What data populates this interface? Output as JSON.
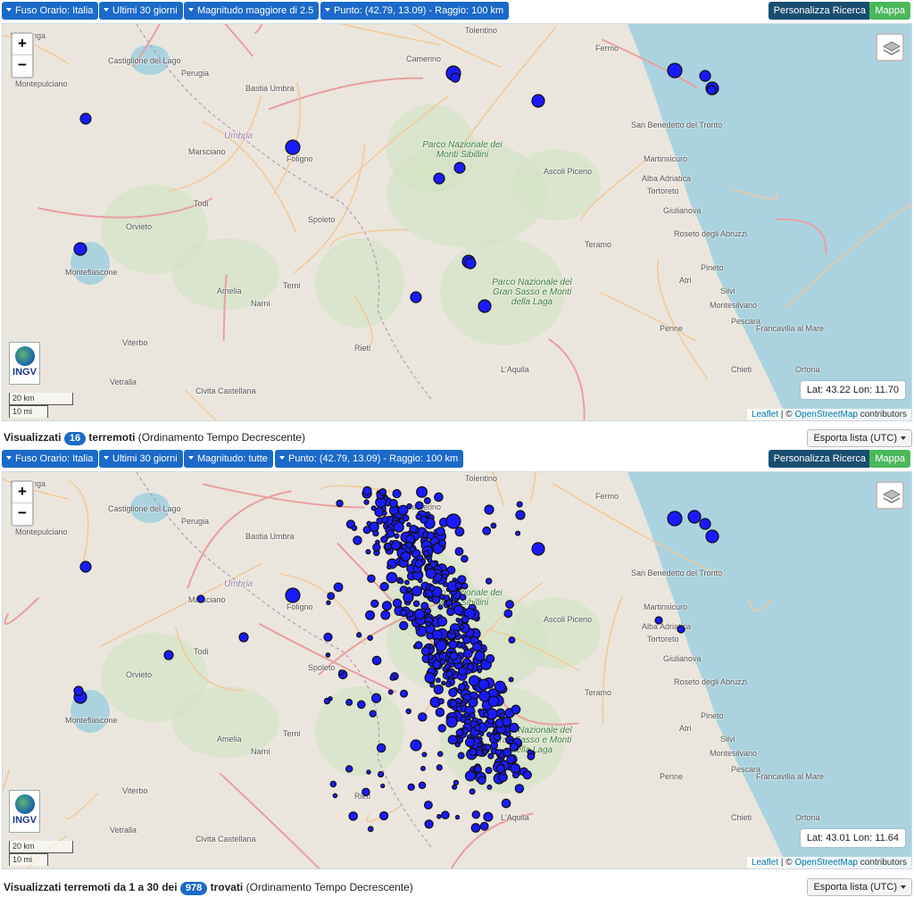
{
  "panels": [
    {
      "filters": {
        "timezone": "Fuso Orario: Italia",
        "period": "Ultimi 30 giorni",
        "magnitude": "Magnitudo maggiore di 2.5",
        "point": "Punto: (42.79, 13.09) - Raggio: 100 km"
      },
      "personalize_label": "Personalizza Ricerca",
      "map_label": "Mappa",
      "coords": "Lat: 43.22 Lon: 11.70",
      "summary": {
        "prefix": "Visualizzati",
        "count": "16",
        "noun": "terremoti",
        "sort": "(Ordinamento Tempo Decrescente)"
      },
      "export_label": "Esporta lista (UTC)",
      "quake_count_shown": 16
    },
    {
      "filters": {
        "timezone": "Fuso Orario: Italia",
        "period": "Ultimi 30 giorni",
        "magnitude": "Magnitudo: tutte",
        "point": "Punto: (42.79, 13.09) - Raggio: 100 km"
      },
      "personalize_label": "Personalizza Ricerca",
      "map_label": "Mappa",
      "coords": "Lat: 43.01 Lon: 11.64",
      "summary": {
        "prefix": "Visualizzati terremoti da 1 a 30 dei",
        "count": "978",
        "noun": "trovati",
        "sort": "(Ordinamento Tempo Decrescente)"
      },
      "export_label": "Esporta lista (UTC)",
      "quake_count_shown": 978
    }
  ],
  "map": {
    "zoom_in": "+",
    "zoom_out": "−",
    "logo_text": "INGV",
    "scale_km": "20 km",
    "scale_mi": "10 mi",
    "attribution_leaflet": "Leaflet",
    "attribution_sep": " | © ",
    "attribution_osm": "OpenStreetMap",
    "attribution_suffix": " contributors",
    "places": [
      "Sinalunga",
      "Castiglione del Lago",
      "Montepulciano",
      "Perugia",
      "Bastia Umbra",
      "Marsciano",
      "Umbria",
      "Foligno",
      "Todi",
      "Orvieto",
      "Spoleto",
      "Montefiascone",
      "Amelia",
      "Terni",
      "Narni",
      "Viterbo",
      "Vetralla",
      "Civita Castellana",
      "Rieti",
      "L'Aquila",
      "Camerino",
      "Tolentino",
      "Fermo",
      "San Benedetto del Tronto",
      "Ascoli Piceno",
      "Martinsicuro",
      "Alba Adriatica",
      "Tortoreto",
      "Giulianova",
      "Roseto degli Abruzzi",
      "Teramo",
      "Pineto",
      "Atri",
      "Silvi",
      "Montesilvano",
      "Pescara",
      "Francavilla al Mare",
      "Penne",
      "Chieti",
      "Ortona"
    ],
    "parks": [
      "Parco Nazionale dei Monti Sibillini",
      "Parco Nazionale del Gran Sasso e Monti della Laga"
    ]
  },
  "colors": {
    "accent": "#1b6ac9",
    "personalize": "#194e71",
    "map_button": "#4bb85a",
    "quake": "#1a1aff",
    "sea": "#aad3df"
  }
}
